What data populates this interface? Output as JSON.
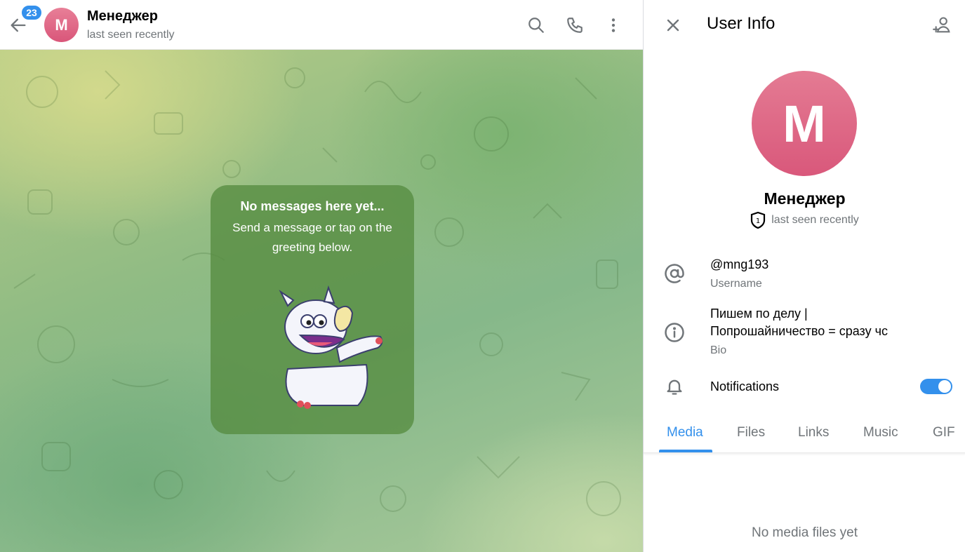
{
  "chat_header": {
    "unread_count": "23",
    "avatar_letter": "M",
    "title": "Менеджер",
    "status": "last seen recently"
  },
  "empty_state": {
    "title": "No messages here yet...",
    "subtitle": "Send a message or tap on the greeting below."
  },
  "user_info": {
    "header_title": "User Info",
    "avatar_letter": "M",
    "name": "Менеджер",
    "status": "last seen recently",
    "status_badge": "1",
    "username": "@mng193",
    "username_label": "Username",
    "bio_line1": "Пишем по делу |",
    "bio_line2": "Попрошайничество = сразу чс",
    "bio_label": "Bio",
    "notifications_label": "Notifications",
    "notifications_enabled": true,
    "tabs": [
      {
        "label": "Media",
        "active": true
      },
      {
        "label": "Files",
        "active": false
      },
      {
        "label": "Links",
        "active": false
      },
      {
        "label": "Music",
        "active": false
      },
      {
        "label": "GIF",
        "active": false
      }
    ],
    "empty_media": "No media files yet"
  },
  "colors": {
    "accent": "#3390ec",
    "avatar": "#d9587b",
    "secondary_text": "#707579",
    "card_bg": "#568c40"
  },
  "icons": [
    "back-arrow-icon",
    "search-icon",
    "phone-icon",
    "more-vertical-icon",
    "close-icon",
    "add-contact-icon",
    "shield-icon",
    "at-icon",
    "info-icon",
    "bell-icon"
  ]
}
